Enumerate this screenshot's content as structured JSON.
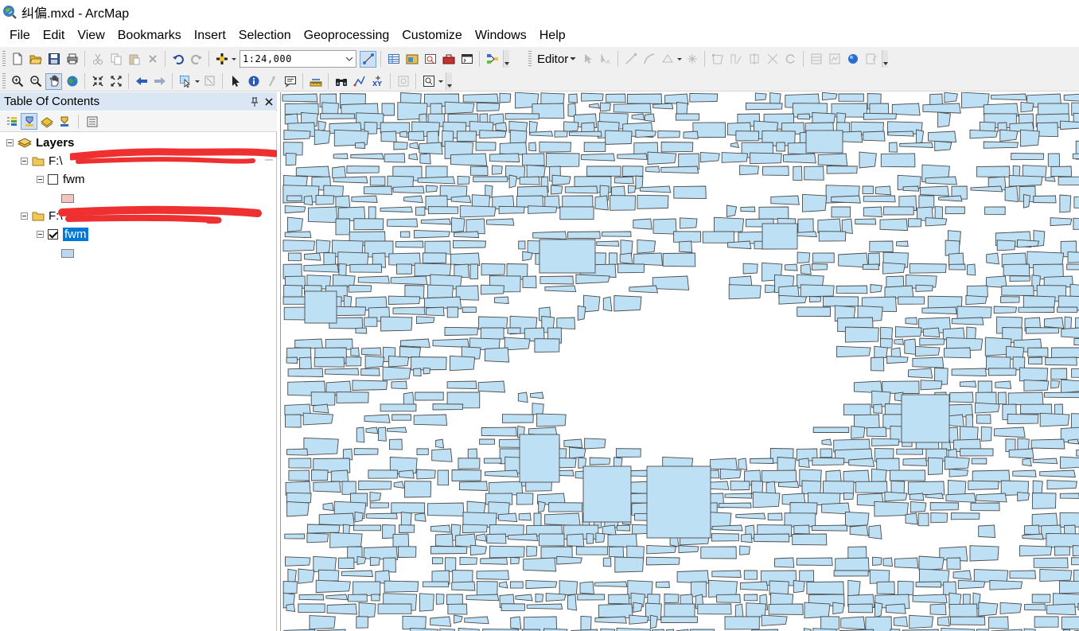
{
  "window": {
    "title": "纠偏.mxd - ArcMap"
  },
  "menu": [
    "File",
    "Edit",
    "View",
    "Bookmarks",
    "Insert",
    "Selection",
    "Geoprocessing",
    "Customize",
    "Windows",
    "Help"
  ],
  "toolbar": {
    "scale": "1:24,000",
    "editor_label": "Editor",
    "row1_icons": [
      "new-document-icon",
      "open-folder-icon",
      "save-icon",
      "print-icon",
      "cut-icon",
      "copy-icon",
      "paste-icon",
      "delete-icon",
      "undo-icon",
      "redo-icon",
      "add-data-icon",
      "editor-toolbar-icon",
      "table-icon",
      "arccatalog-icon",
      "search-window-icon",
      "arctoolbox-icon",
      "python-icon",
      "model-builder-icon"
    ],
    "row2_icons": [
      "zoom-in-icon",
      "zoom-out-icon",
      "pan-icon",
      "full-extent-icon",
      "fixed-zoom-in-icon",
      "fixed-zoom-out-icon",
      "back-icon",
      "forward-icon",
      "select-features-icon",
      "clear-selection-icon",
      "select-elements-icon",
      "identify-icon",
      "hyperlink-icon",
      "html-popup-icon",
      "measure-icon",
      "find-icon",
      "find-route-icon",
      "go-to-xy-icon",
      "time-slider-icon",
      "viewer-window-icon"
    ]
  },
  "toc": {
    "title": "Table Of Contents",
    "pin_icon": "pin-icon",
    "close_icon": "close-icon",
    "root_label": "Layers",
    "groups": [
      {
        "path": "F:\\",
        "layer": "fwm",
        "checked": false,
        "symbol_color": "#f5c4bc"
      },
      {
        "path": "F:\\",
        "layer": "fwm",
        "checked": true,
        "selected": true,
        "symbol_color": "#bdd7ee"
      }
    ]
  },
  "map": {
    "fill_color": "#bee0f4",
    "outline_color": "#4a4a4a",
    "background": "#ffffff"
  }
}
